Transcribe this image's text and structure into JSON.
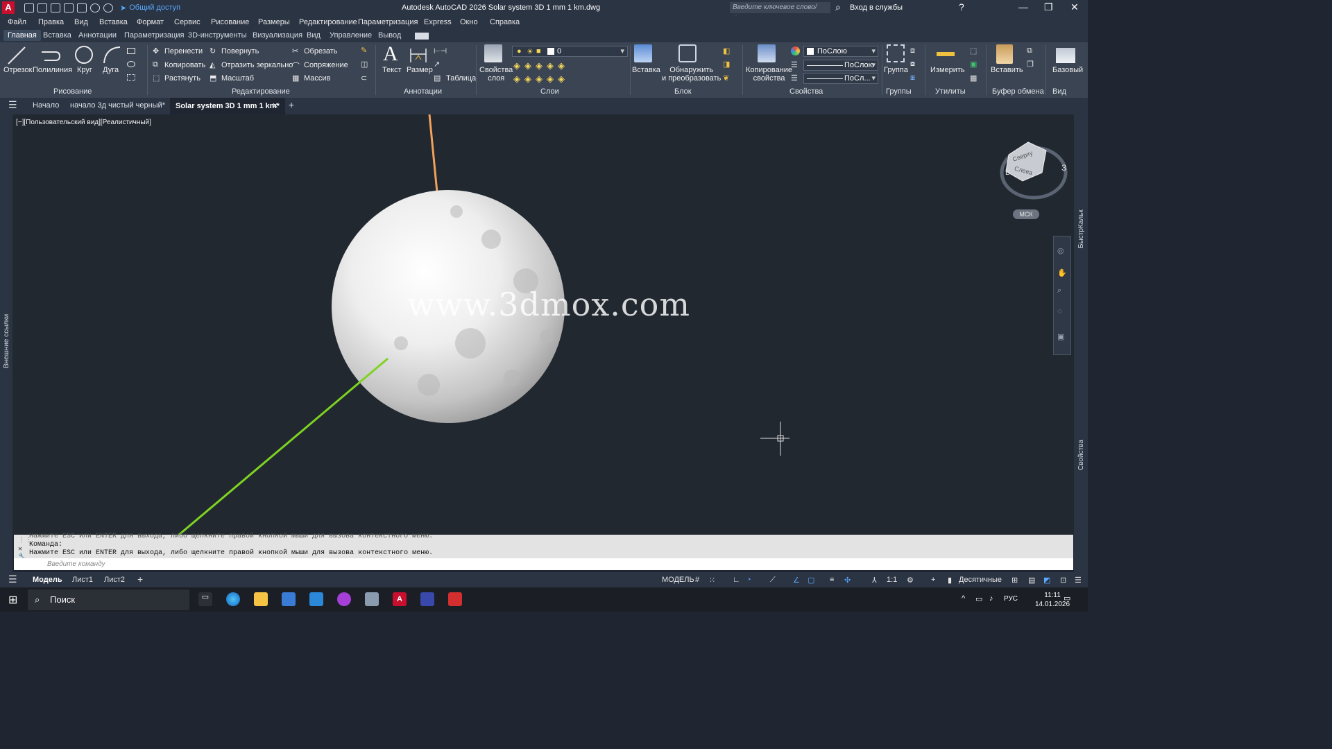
{
  "titlebar": {
    "logo": "A",
    "share_label": "Общий доступ",
    "title": "Autodesk AutoCAD 2026    Solar system 3D  1 mm 1 km.dwg",
    "search_placeholder": "Введите ключевое слово/фразу",
    "login_label": "Вход в службы"
  },
  "menu": [
    "Файл",
    "Правка",
    "Вид",
    "Вставка",
    "Формат",
    "Сервис",
    "Рисование",
    "Размеры",
    "Редактирование",
    "Параметризация",
    "Express",
    "Окно",
    "Справка"
  ],
  "ribbon_tabs": [
    "Главная",
    "Вставка",
    "Аннотации",
    "Параметризация",
    "3D-инструменты",
    "Визуализация",
    "Вид",
    "Управление",
    "Вывод"
  ],
  "ribbon": {
    "draw": [
      "Отрезок",
      "Полилиния",
      "Круг",
      "Дуга"
    ],
    "draw_panel": "Рисование",
    "modify": [
      "Перенести",
      "Повернуть",
      "Обрезать",
      "Копировать",
      "Отразить зеркально",
      "Сопряжение",
      "Растянуть",
      "Масштаб",
      "Массив"
    ],
    "modify_panel": "Редактирование",
    "annot": [
      "Текст",
      "Размер",
      "Таблица"
    ],
    "annot_panel": "Аннотации",
    "layer_props": "Свойства\nслоя",
    "layer_value": "0",
    "layers_panel": "Слои",
    "insert": "Вставка",
    "detect": "Обнаружить\nи преобразовать",
    "block_panel": "Блок",
    "copy_props": "Копирование\nсвойства",
    "bylayer": "ПоСлою",
    "bylayer2": "ПоСлою",
    "bylayer3": "ПоСл...",
    "props_panel": "Свойства",
    "group": "Группа",
    "groups_panel": "Группы",
    "measure": "Измерить",
    "utils_panel": "Утилиты",
    "paste": "Вставить",
    "clipboard_panel": "Буфер обмена",
    "base": "Базовый",
    "view_panel": "Вид"
  },
  "doc_tabs": [
    "Начало",
    "начало 3д чистый черный*",
    "Solar system 3D  1 mm 1 km*"
  ],
  "viewport": {
    "label": "[−][Пользовательский вид][Реалистичный]",
    "watermark": "www.3dmox.com",
    "wcs": "МСК",
    "cube_labels": [
      "Сверху",
      "Слева",
      "З",
      "В"
    ]
  },
  "side": {
    "left": "Внешние ссылки",
    "right_top": "БыстрКальк",
    "right_bottom": "Свойства"
  },
  "command": {
    "line1": "Нажмите ESC или ENTER для выхода, либо щелкните правой кнопкой мыши для вызова контекстного меню.",
    "line2": "Команда:",
    "line3": "Нажмите ESC или ENTER для выхода, либо щелкните правой кнопкой мыши для вызова контекстного меню.",
    "placeholder": "Введите команду"
  },
  "status": {
    "tabs": [
      "Модель",
      "Лист1",
      "Лист2"
    ],
    "model": "МОДЕЛЬ",
    "scale": "1:1",
    "units": "Десятичные"
  },
  "taskbar": {
    "search": "Поиск",
    "lang": "РУС",
    "time": "11:11",
    "date": "14.01.2026"
  }
}
